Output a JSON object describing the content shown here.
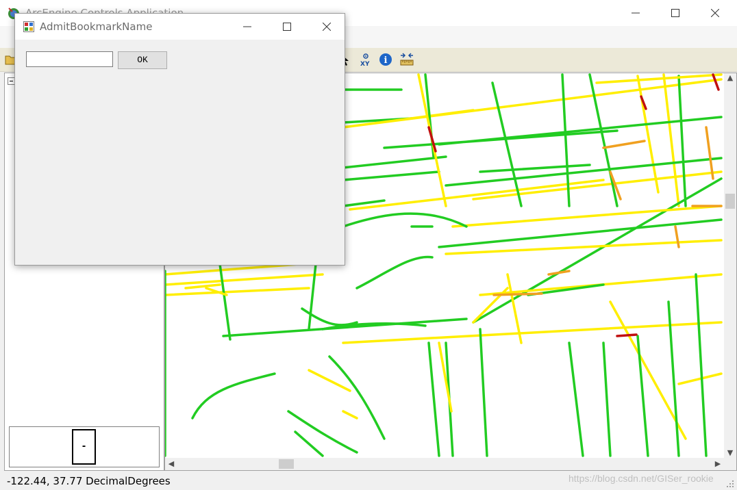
{
  "app": {
    "title": "ArcEngine Controls Application"
  },
  "dialog": {
    "title": "AdmitBookmarkName",
    "input_value": "",
    "ok_label": "OK"
  },
  "overview": {
    "extent_label": "-"
  },
  "status": {
    "coords": "-122.44, 37.77  DecimalDegrees"
  },
  "watermark": "https://blog.csdn.net/GISer_rookie",
  "colors": {
    "green": "#22cc22",
    "yellow": "#ffee00",
    "orange": "#f0a020",
    "red": "#c01010"
  },
  "icons": [
    "arcengine-app-icon",
    "open-folder-icon",
    "select-arrow-icon",
    "xy-icon",
    "identify-icon",
    "measure-icon",
    "form-icon"
  ]
}
